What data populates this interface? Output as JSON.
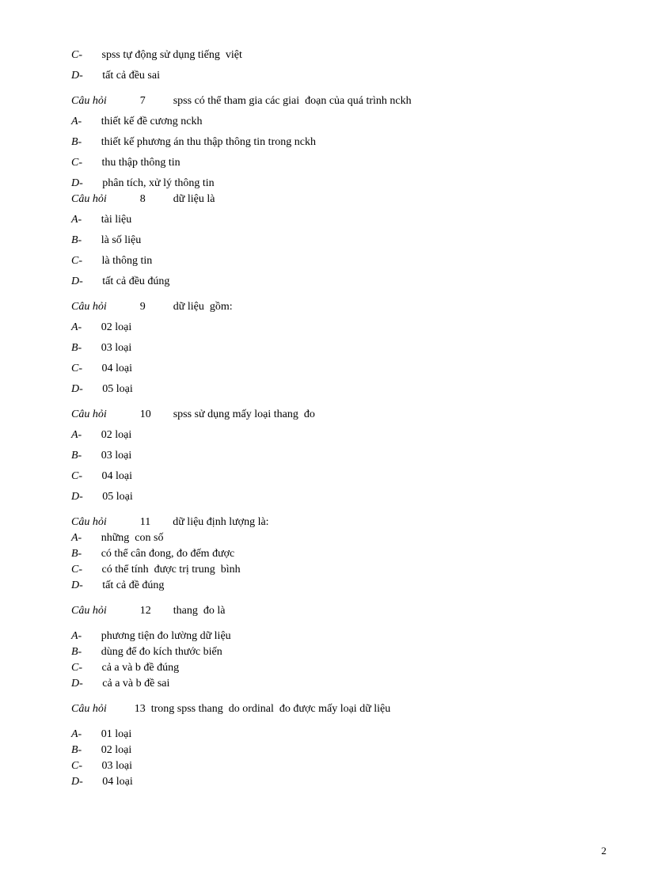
{
  "orphan_options": [
    {
      "letter": "C-",
      "text": "spss tự động sử dụng tiếng  việt"
    },
    {
      "letter": "D-",
      "text": "tất cả đều sai"
    }
  ],
  "questions": [
    {
      "label": "Câu hỏi",
      "number": "7",
      "text": "spss có thể tham gia các giai  đoạn của quá trình nckh",
      "options": [
        {
          "letter": "A-",
          "text": "thiết kế đề cương nckh"
        },
        {
          "letter": "B-",
          "text": "thiết kế phương án thu thập thông tin trong nckh"
        },
        {
          "letter": "C-",
          "text": "thu thập thông tin"
        },
        {
          "letter": "D-",
          "text": "phân tích, xử lý thông tin"
        }
      ],
      "tight_after_d": true,
      "gap_before": true
    },
    {
      "label": "Câu hỏi",
      "number": "8",
      "text": "dữ liệu là",
      "options": [
        {
          "letter": "A-",
          "text": "tài liệu"
        },
        {
          "letter": "B-",
          "text": "là số liệu"
        },
        {
          "letter": "C-",
          "text": "là thông tin"
        },
        {
          "letter": "D-",
          "text": "tất cả đều đúng"
        }
      ],
      "gap_before": false
    },
    {
      "label": "Câu hỏi",
      "number": "9",
      "text": "dữ liệu  gồm:",
      "options": [
        {
          "letter": "A-",
          "text": "02 loại"
        },
        {
          "letter": "B-",
          "text": "03 loại"
        },
        {
          "letter": "C-",
          "text": "04 loại"
        },
        {
          "letter": "D-",
          "text": "05 loại"
        }
      ],
      "gap_before": true
    },
    {
      "label": "Câu hỏi",
      "number": "10",
      "text": "spss sử dụng mấy loại thang  đo",
      "options": [
        {
          "letter": "A-",
          "text": "02 loại"
        },
        {
          "letter": "B-",
          "text": "03 loại"
        },
        {
          "letter": "C-",
          "text": "04 loại"
        },
        {
          "letter": "D-",
          "text": "05 loại"
        }
      ],
      "gap_before": true
    },
    {
      "label": "Câu hỏi",
      "number": "11",
      "text": "dữ liệu định lượng là:",
      "options": [
        {
          "letter": "A-",
          "text": "những  con số"
        },
        {
          "letter": "B-",
          "text": "có thể cân đong, đo đếm được"
        },
        {
          "letter": "C-",
          "text": "có thể tính  được trị trung  bình"
        },
        {
          "letter": "D-",
          "text": "tất cả đề đúng"
        }
      ],
      "tight_options": true,
      "gap_before": true
    },
    {
      "label": "Câu hỏi",
      "number": "12",
      "text": "thang  đo là",
      "options": [
        {
          "letter": "A-",
          "text": "phương tiện đo lường dữ liệu"
        },
        {
          "letter": "B-",
          "text": "dùng để đo kích thước biến"
        },
        {
          "letter": "C-",
          "text": "cả a và b đề đúng"
        },
        {
          "letter": "D-",
          "text": "cả a và b đề sai"
        }
      ],
      "tight_options": true,
      "gap_before": true,
      "option_gap_before": true
    },
    {
      "label": "Câu hỏi",
      "number": "13",
      "text": "trong spss thang  do ordinal  đo được mấy loại dữ liệu",
      "number_spacing": "narrow",
      "options": [
        {
          "letter": "A-",
          "text": "01 loại"
        },
        {
          "letter": "B-",
          "text": "02 loại"
        },
        {
          "letter": "C-",
          "text": "03 loại"
        },
        {
          "letter": "D-",
          "text": "04 loại"
        }
      ],
      "tight_options": true,
      "gap_before": true,
      "option_gap_before": true
    }
  ],
  "page_number": "2"
}
